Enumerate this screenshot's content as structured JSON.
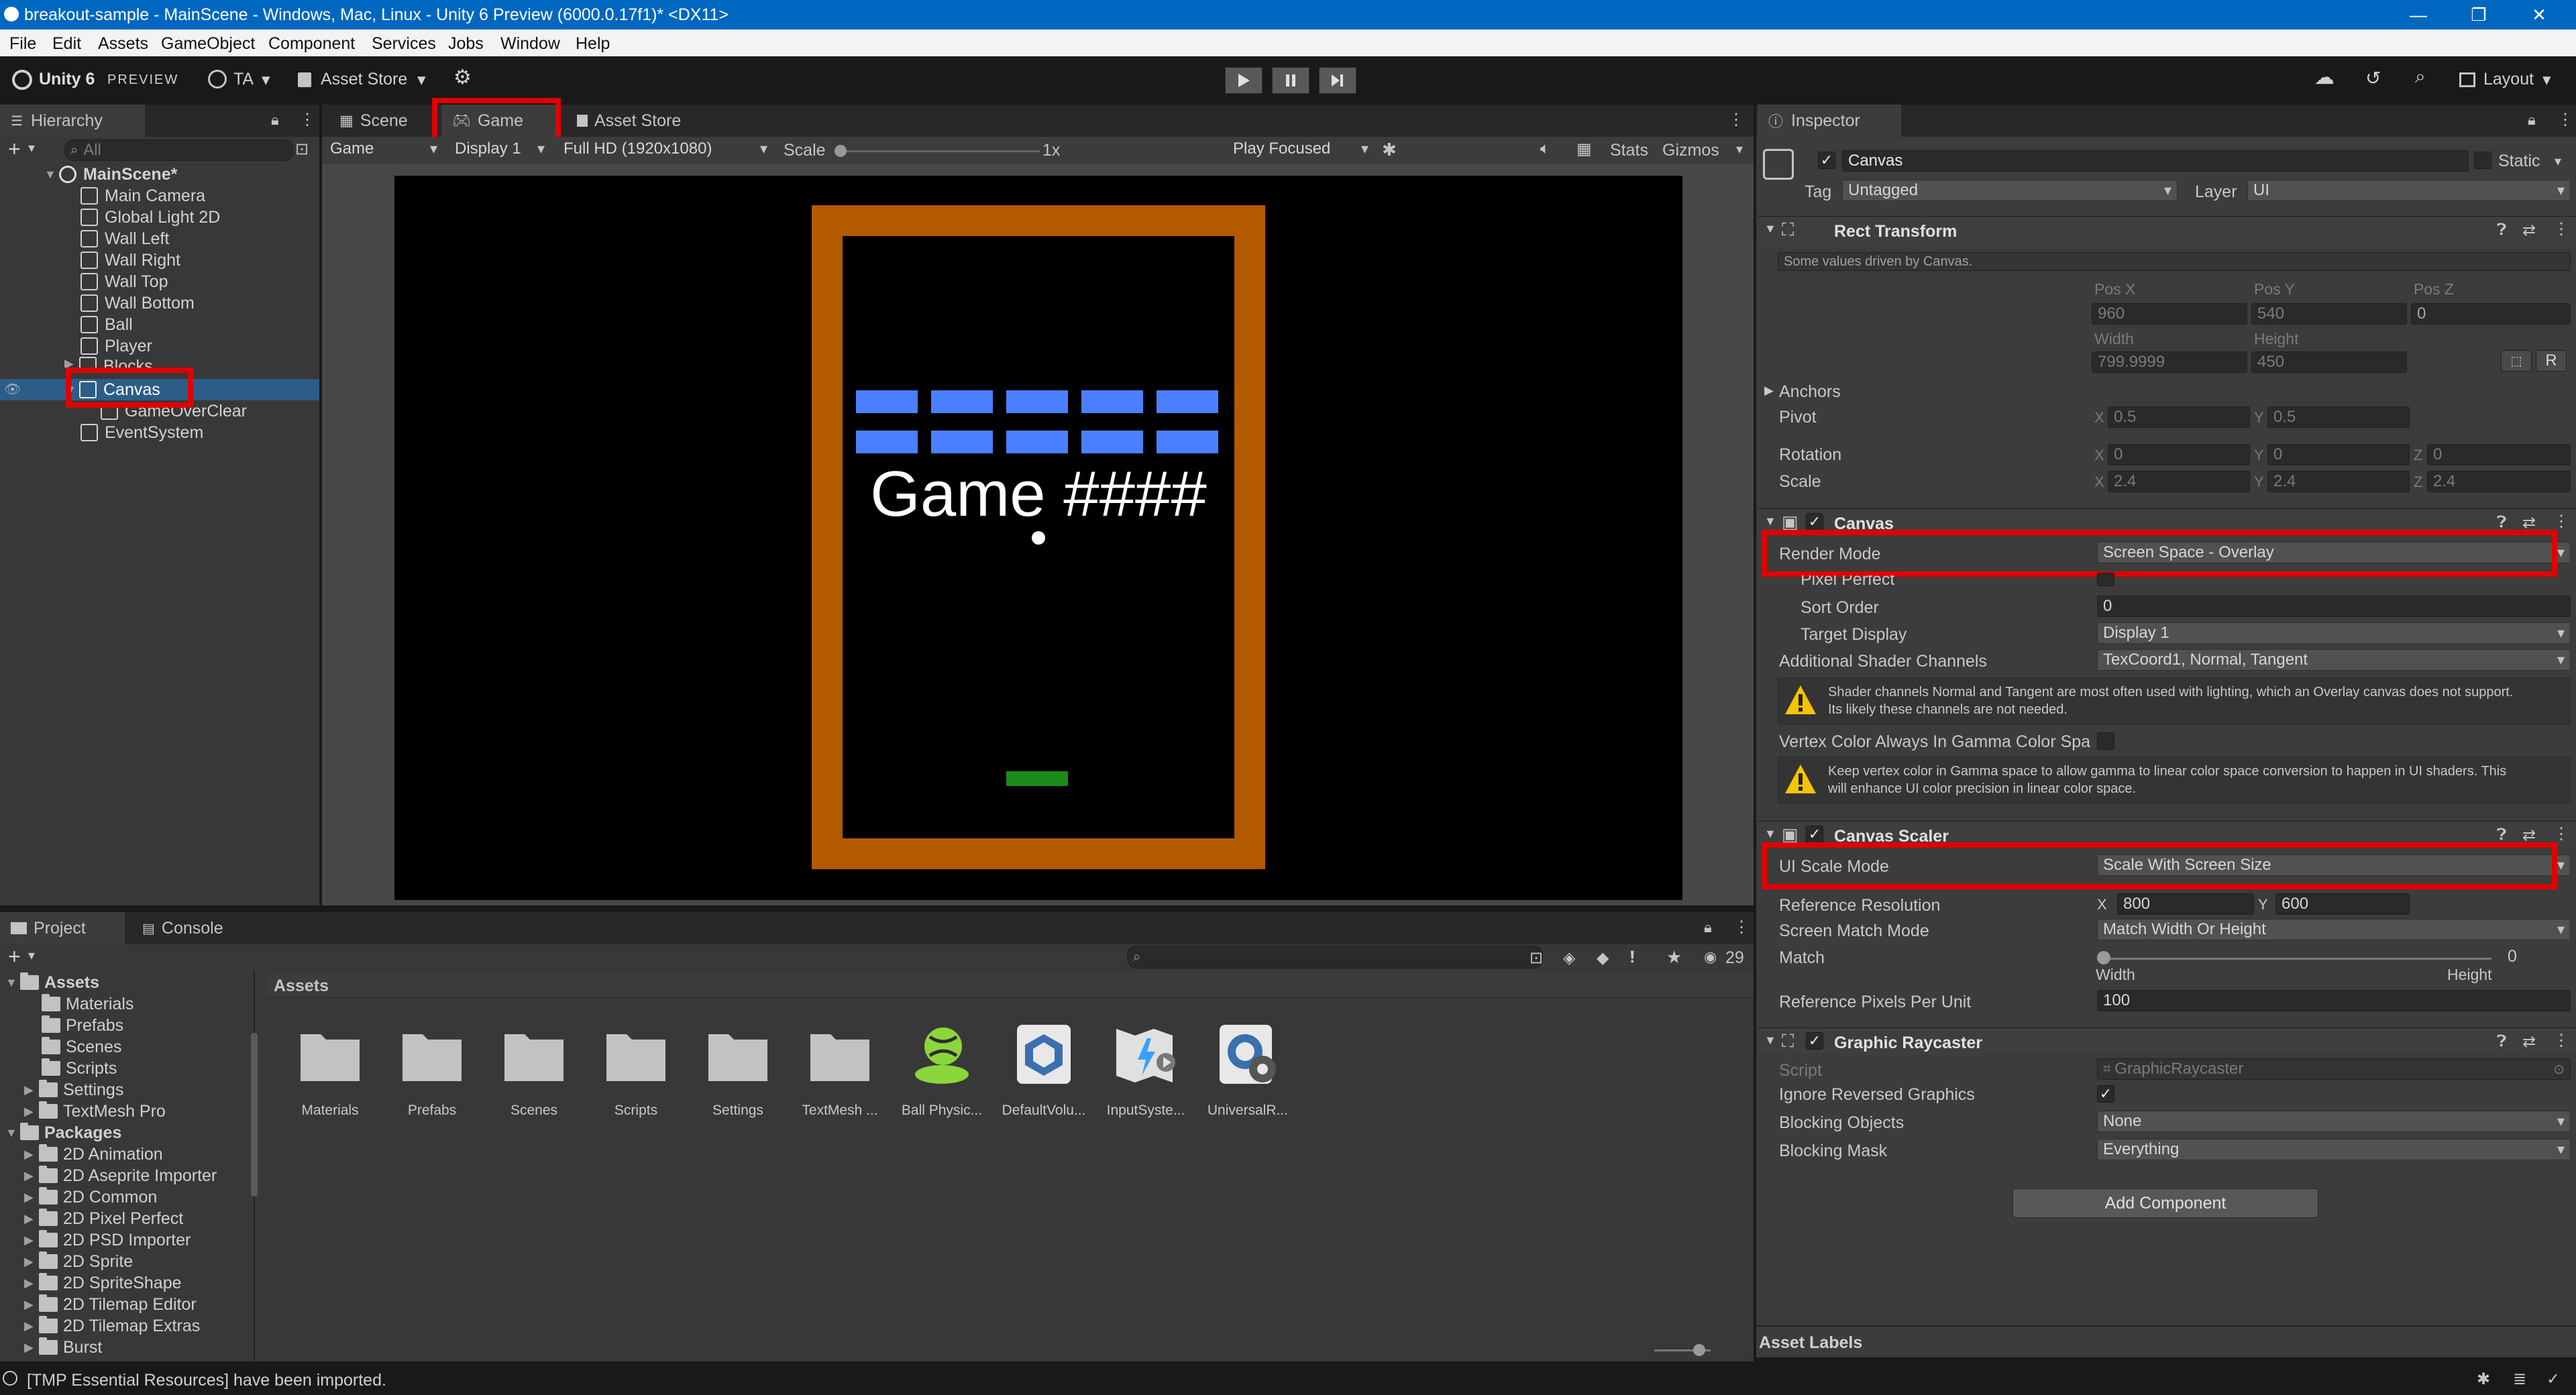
{
  "window": {
    "title": "breakout-sample - MainScene - Windows, Mac, Linux - Unity 6 Preview (6000.0.17f1)* <DX11>",
    "controls": [
      "—",
      "❐",
      "✕"
    ]
  },
  "menu": [
    "File",
    "Edit",
    "Assets",
    "GameObject",
    "Component",
    "Services",
    "Jobs",
    "Window",
    "Help"
  ],
  "toolbar": {
    "logo": "Unity 6",
    "preview": "PREVIEW",
    "account": "TA",
    "asset_store": "Asset Store",
    "layout": "Layout"
  },
  "hierarchy": {
    "tab": "Hierarchy",
    "search_placeholder": "All",
    "scene": "MainScene*",
    "items": [
      "Main Camera",
      "Global Light 2D",
      "Wall Left",
      "Wall Right",
      "Wall Top",
      "Wall Bottom",
      "Ball",
      "Player",
      "Blocks",
      "Canvas",
      "GameOverClear",
      "EventSystem"
    ]
  },
  "game_view": {
    "tabs": [
      "Scene",
      "Game",
      "Asset Store"
    ],
    "toolbar": {
      "mode": "Game",
      "display": "Display 1",
      "resolution": "Full HD (1920x1080)",
      "scale_label": "Scale",
      "scale_value": "1x",
      "play_mode": "Play Focused",
      "stats": "Stats",
      "gizmos": "Gizmos"
    },
    "overlay_text": "Game ####",
    "colors": {
      "wall": "#b35900",
      "block": "#4a80ff",
      "paddle": "#1a8a1a",
      "ball": "#ffffff"
    }
  },
  "inspector": {
    "tab": "Inspector",
    "object_name": "Canvas",
    "static_label": "Static",
    "tag_label": "Tag",
    "tag_value": "Untagged",
    "layer_label": "Layer",
    "layer_value": "UI",
    "rect_transform": {
      "title": "Rect Transform",
      "note": "Some values driven by Canvas.",
      "pos_x_label": "Pos X",
      "pos_x": "960",
      "pos_y_label": "Pos Y",
      "pos_y": "540",
      "pos_z_label": "Pos Z",
      "pos_z": "0",
      "width_label": "Width",
      "width": "799.9999",
      "height_label": "Height",
      "height": "450",
      "anchors": "Anchors",
      "pivot": "Pivot",
      "pivot_x": "0.5",
      "pivot_y": "0.5",
      "rotation": "Rotation",
      "rot_x": "0",
      "rot_y": "0",
      "rot_z": "0",
      "scale": "Scale",
      "scale_x": "2.4",
      "scale_y": "2.4",
      "scale_z": "2.4",
      "r_button": "R"
    },
    "canvas": {
      "title": "Canvas",
      "render_mode_label": "Render Mode",
      "render_mode": "Screen Space - Overlay",
      "pixel_perfect": "Pixel Perfect",
      "sort_order_label": "Sort Order",
      "sort_order": "0",
      "target_display_label": "Target Display",
      "target_display": "Display 1",
      "shader_channels_label": "Additional Shader Channels",
      "shader_channels": "TexCoord1, Normal, Tangent",
      "warning1_line1": "Shader channels Normal and Tangent are most often used with lighting, which an Overlay canvas does not support.",
      "warning1_line2": "Its likely these channels are not needed.",
      "vertex_color_label": "Vertex Color Always In Gamma Color Spa",
      "warning2_line1": "Keep vertex color in Gamma space to allow gamma to linear color space conversion to happen in UI shaders. This",
      "warning2_line2": "will enhance UI color precision in linear color space."
    },
    "canvas_scaler": {
      "title": "Canvas Scaler",
      "ui_scale_mode_label": "UI Scale Mode",
      "ui_scale_mode": "Scale With Screen Size",
      "ref_res_label": "Reference Resolution",
      "ref_x": "800",
      "ref_y": "600",
      "match_mode_label": "Screen Match Mode",
      "match_mode": "Match Width Or Height",
      "match_label": "Match",
      "match_value": "0",
      "match_width": "Width",
      "match_height": "Height",
      "ppu_label": "Reference Pixels Per Unit",
      "ppu": "100"
    },
    "graphic_raycaster": {
      "title": "Graphic Raycaster",
      "script_label": "Script",
      "script": "GraphicRaycaster",
      "ignore_reversed_label": "Ignore Reversed Graphics",
      "blocking_objects_label": "Blocking Objects",
      "blocking_objects": "None",
      "blocking_mask_label": "Blocking Mask",
      "blocking_mask": "Everything"
    },
    "add_component": "Add Component",
    "asset_labels": "Asset Labels"
  },
  "project": {
    "tabs": [
      "Project",
      "Console"
    ],
    "hidden_count": "29",
    "breadcrumb": "Assets",
    "tree_assets": "Assets",
    "tree_asset_children": [
      "Materials",
      "Prefabs",
      "Scenes",
      "Scripts",
      "Settings",
      "TextMesh Pro"
    ],
    "tree_packages": "Packages",
    "tree_package_children": [
      "2D Animation",
      "2D Aseprite Importer",
      "2D Common",
      "2D Pixel Perfect",
      "2D PSD Importer",
      "2D Sprite",
      "2D SpriteShape",
      "2D Tilemap Editor",
      "2D Tilemap Extras",
      "Burst"
    ],
    "assets": [
      "Materials",
      "Prefabs",
      "Scenes",
      "Scripts",
      "Settings",
      "TextMesh ...",
      "Ball Physic...",
      "DefaultVolu...",
      "InputSyste...",
      "UniversalR..."
    ]
  },
  "status_bar": {
    "message": "[TMP Essential Resources] have been imported."
  }
}
